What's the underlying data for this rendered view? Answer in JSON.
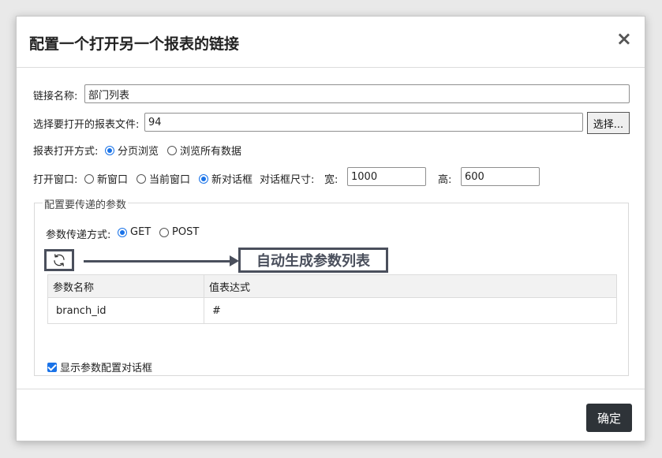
{
  "dialog": {
    "title": "配置一个打开另一个报表的链接",
    "close": "×"
  },
  "form": {
    "link_name_label": "链接名称:",
    "link_name_value": "部门列表",
    "report_file_label": "选择要打开的报表文件:",
    "report_file_value": "94",
    "select_button": "选择...",
    "open_mode_label": "报表打开方式:",
    "open_mode_options": [
      "分页浏览",
      "浏览所有数据"
    ],
    "open_mode_selected": "分页浏览",
    "window_label": "打开窗口:",
    "window_options": [
      "新窗口",
      "当前窗口",
      "新对话框"
    ],
    "window_selected": "新对话框",
    "dialog_size_label": "对话框尺寸:",
    "width_label": "宽:",
    "width_value": "1000",
    "height_label": "高:",
    "height_value": "600"
  },
  "params": {
    "legend": "配置要传递的参数",
    "method_label": "参数传递方式:",
    "method_options": [
      "GET",
      "POST"
    ],
    "method_selected": "GET",
    "auto_generate_callout": "自动生成参数列表",
    "table": {
      "headers": [
        "参数名称",
        "值表达式"
      ],
      "rows": [
        [
          "branch_id",
          "#"
        ]
      ]
    },
    "show_dialog_label": "显示参数配置对话框",
    "show_dialog_checked": true
  },
  "footer": {
    "ok_button": "确定"
  },
  "icons": {
    "refresh": "refresh-icon",
    "close": "close-icon"
  },
  "colors": {
    "accent": "#1a73e8",
    "annotation": "#4a4f5c",
    "ok_button": "#2e3338"
  }
}
